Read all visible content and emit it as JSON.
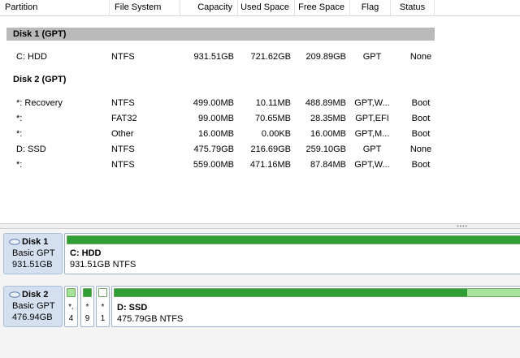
{
  "columns": [
    "Partition",
    "File System",
    "Capacity",
    "Used Space",
    "Free Space",
    "Flag",
    "Status"
  ],
  "disks": [
    {
      "heading": "Disk 1 (GPT)",
      "rows": [
        {
          "partition": "C: HDD",
          "fs": "NTFS",
          "capacity": "931.51GB",
          "used": "721.62GB",
          "free": "209.89GB",
          "flag": "GPT",
          "status": "None"
        }
      ]
    },
    {
      "heading": "Disk 2 (GPT)",
      "rows": [
        {
          "partition": "*: Recovery",
          "fs": "NTFS",
          "capacity": "499.00MB",
          "used": "10.11MB",
          "free": "488.89MB",
          "flag": "GPT,W...",
          "status": "Boot"
        },
        {
          "partition": "*:",
          "fs": "FAT32",
          "capacity": "99.00MB",
          "used": "70.65MB",
          "free": "28.35MB",
          "flag": "GPT,EFI",
          "status": "Boot"
        },
        {
          "partition": "*:",
          "fs": "Other",
          "capacity": "16.00MB",
          "used": "0.00KB",
          "free": "16.00MB",
          "flag": "GPT,M...",
          "status": "Boot"
        },
        {
          "partition": "D: SSD",
          "fs": "NTFS",
          "capacity": "475.79GB",
          "used": "216.69GB",
          "free": "259.10GB",
          "flag": "GPT",
          "status": "None"
        },
        {
          "partition": "*:",
          "fs": "NTFS",
          "capacity": "559.00MB",
          "used": "471.16MB",
          "free": "87.84MB",
          "flag": "GPT,W...",
          "status": "Boot"
        }
      ]
    }
  ],
  "map": {
    "disk1": {
      "title": "Disk 1",
      "type": "Basic GPT",
      "size": "931.51GB",
      "partition": {
        "name": "C: HDD",
        "desc": "931.51GB NTFS",
        "used_fraction": 1.0
      }
    },
    "disk2": {
      "title": "Disk 2",
      "type": "Basic GPT",
      "size": "476.94GB",
      "small_parts": [
        {
          "mark": "*.",
          "num": "4"
        },
        {
          "mark": "*",
          "num": "9"
        },
        {
          "mark": "*",
          "num": "1"
        }
      ],
      "partition": {
        "name": "D: SSD",
        "desc": "475.79GB NTFS",
        "used_fraction": 0.87
      }
    }
  },
  "colors": {
    "used": "#2f9e34",
    "free": "#a8e29a",
    "disk_card": "#d4e0ef",
    "selected_heading": "#b9b9b9"
  }
}
